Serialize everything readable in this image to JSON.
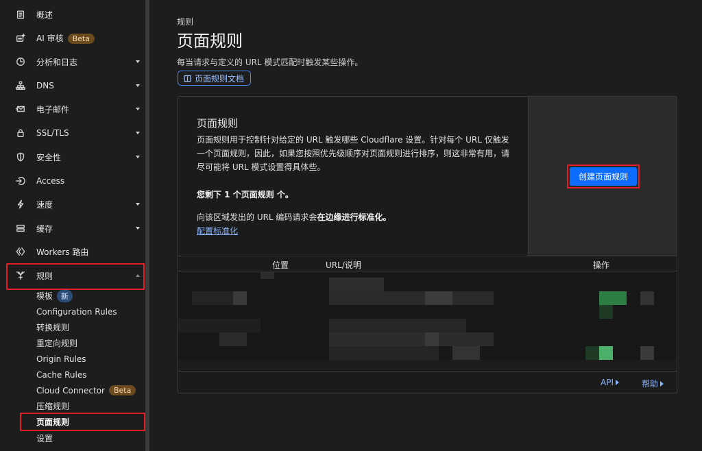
{
  "sidebar": {
    "items": [
      {
        "label": "概述",
        "icon": "clipboard-icon"
      },
      {
        "label": "AI 审核",
        "icon": "ai-audit-icon",
        "badge": "Beta"
      },
      {
        "label": "分析和日志",
        "icon": "clock-chart-icon"
      },
      {
        "label": "DNS",
        "icon": "network-icon"
      },
      {
        "label": "电子邮件",
        "icon": "mail-icon"
      },
      {
        "label": "SSL/TLS",
        "icon": "lock-icon"
      },
      {
        "label": "安全性",
        "icon": "shield-icon"
      },
      {
        "label": "Access",
        "icon": "access-icon"
      },
      {
        "label": "速度",
        "icon": "bolt-icon"
      },
      {
        "label": "缓存",
        "icon": "cache-icon"
      },
      {
        "label": "Workers 路由",
        "icon": "workers-icon"
      },
      {
        "label": "规则",
        "icon": "rules-icon"
      }
    ],
    "sub_items": [
      {
        "label": "模板",
        "badge": "新"
      },
      {
        "label": "Configuration Rules"
      },
      {
        "label": "转换规则"
      },
      {
        "label": "重定向规则"
      },
      {
        "label": "Origin Rules"
      },
      {
        "label": "Cache Rules"
      },
      {
        "label": "Cloud Connector",
        "badge": "Beta"
      },
      {
        "label": "压缩规则"
      },
      {
        "label": "页面规则"
      },
      {
        "label": "设置"
      }
    ]
  },
  "main": {
    "breadcrumb": "规则",
    "title": "页面规则",
    "description": "每当请求与定义的 URL 模式匹配时触发某些操作。",
    "doc_button": "页面规则文档",
    "card": {
      "title": "页面规则",
      "body": "页面规则用于控制针对给定的 URL 触发哪些 Cloudflare 设置。针对每个 URL 仅触发一个页面规则，因此，如果您按照优先级顺序对页面规则进行排序，则这非常有用，请尽可能将 URL 模式设置得具体些。",
      "remaining": "您剩下 1 个页面规则 个。",
      "normalize_prefix": "向该区域发出的 URL 编码请求会",
      "normalize_bold": "在边缘进行标准化。",
      "normalize_link": "配置标准化",
      "create_button": "创建页面规则"
    },
    "table": {
      "headers": {
        "position": "位置",
        "url": "URL/说明",
        "actions": "操作"
      }
    },
    "footer": {
      "api": "API",
      "help": "帮助"
    }
  },
  "colors": {
    "accent": "#0b6cff",
    "highlight": "#e11d2a",
    "link": "#8ab4ff"
  }
}
